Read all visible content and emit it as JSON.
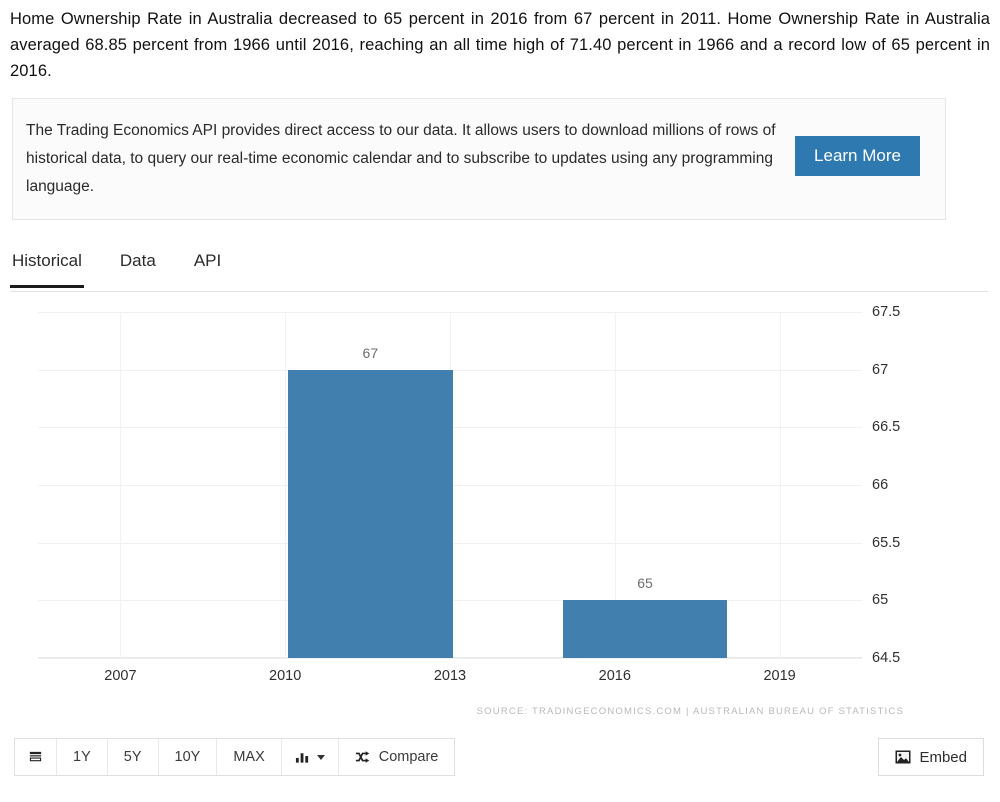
{
  "intro": {
    "paragraph": "Home Ownership Rate in Australia decreased to 65 percent in 2016 from 67 percent in 2011. Home Ownership Rate in Australia averaged 68.85 percent from 1966 until 2016, reaching an all time high of 71.40 percent in 1966 and a record low of 65 percent in 2016."
  },
  "promo": {
    "text": "The Trading Economics API provides direct access to our data. It allows users to download millions of rows of historical data, to query our real-time economic calendar and to subscribe to updates using any programming language.",
    "button_label": "Learn More",
    "button_color": "#2d79b0"
  },
  "tabs": [
    {
      "label": "Historical",
      "active": true
    },
    {
      "label": "Data",
      "active": false
    },
    {
      "label": "API",
      "active": false
    }
  ],
  "chart_data": {
    "type": "bar",
    "title": "",
    "xlabel": "",
    "ylabel": "",
    "categories": [
      "2011",
      "2016"
    ],
    "values": [
      67,
      65
    ],
    "data_labels": [
      "67",
      "65"
    ],
    "series": [
      {
        "name": "Home Ownership Rate",
        "values": [
          67,
          65
        ]
      }
    ],
    "bar_color": "#4180ae",
    "ylim": [
      64.5,
      67.5
    ],
    "yticks": [
      "67.5",
      "67",
      "66.5",
      "66",
      "65.5",
      "65",
      "64.5"
    ],
    "ytick_values": [
      67.5,
      67,
      66.5,
      66,
      65.5,
      65,
      64.5
    ],
    "xticks": [
      "2007",
      "2010",
      "2013",
      "2016",
      "2019"
    ],
    "xtick_values": [
      2007,
      2010,
      2013,
      2016,
      2019
    ],
    "xlim": [
      2005.5,
      2020.5
    ],
    "grid": true,
    "legend": false,
    "source": "SOURCE: TRADINGECONOMICS.COM  |  AUSTRALIAN BUREAU OF STATISTICS"
  },
  "toolbar": {
    "buttons": [
      {
        "name": "list-view",
        "label": "",
        "icon": "list-icon"
      },
      {
        "name": "range-1y",
        "label": "1Y",
        "icon": ""
      },
      {
        "name": "range-5y",
        "label": "5Y",
        "icon": ""
      },
      {
        "name": "range-10y",
        "label": "10Y",
        "icon": ""
      },
      {
        "name": "range-max",
        "label": "MAX",
        "icon": ""
      },
      {
        "name": "chart-type",
        "label": "",
        "icon": "bar-chart-icon"
      },
      {
        "name": "compare",
        "label": "Compare",
        "icon": "shuffle-icon"
      }
    ],
    "embed_label": "Embed"
  }
}
